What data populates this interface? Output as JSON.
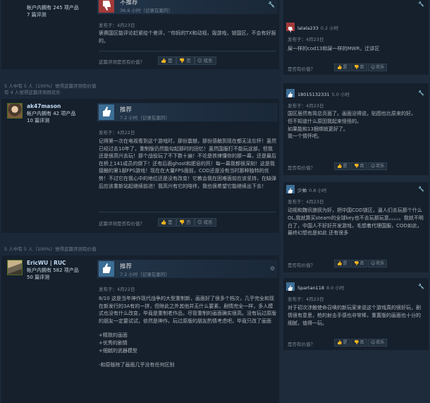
{
  "r0": {
    "stat1": "帐户内拥有 245 项产品",
    "stat2": "7 篇评测",
    "verdict": "不推荐",
    "hours": "36.6 小时（记录在案的）",
    "posted": "发布于：4月23日",
    "text": "褒赛国区能评论赶紧给个差评，‘’你妈的TX和动视，毁游戏，锁国区，不会有好报的。",
    "question": "这篇评测是否有价值？",
    "yes": "是",
    "no": "否",
    "funny": "欢乐"
  },
  "r1": {
    "helpful1": "5 人中有 5 人（100%）觉得这篇评测有价值",
    "helpful2": "有 4 人觉得这篇评测很欢乐",
    "name": "ak47mason",
    "stat1": "帐户内拥有 42 项产品",
    "stat2": "10 篇评测",
    "verdict": "推荐",
    "hours": "7.2 小时（记录在案的）",
    "posted": "发布于：4月22日",
    "text": "记得第一次在电视看到这个游戏时，那份震撼，那份感触到现在都无法忘怀！虽然已经过去10年了，重制版仍然能勾起那时的回忆！虽然国服打不能玩这部，但我还是很高兴去玩！那个战役玩了不下数十遍！不论是铁律懂你的那一幕，还是最后在桥上141成员的倒下！还有后面ghost和肥皂的死！每一幕我都很深刻！这是我接触的第1部FPS游戏！现在在大量FPS面前，COD还是没有当时那种独特的优势！不过它在我心中的地位还是没有改变！它教会我在困难面前应该坚持，在缺弹后应该重新站起继续前进！我高兴有它的陪伴，我也很希望它能继续出下去！",
    "question": "这篇评测是否有价值？",
    "yes": "是",
    "no": "否",
    "funny": "欢乐"
  },
  "r2": {
    "helpful1": "5 人中有 5 人（100%）觉得这篇评测有价值",
    "name": "EricWU | RUC",
    "stat1": "帐户内拥有 582 项产品",
    "stat2": "50 篇评测",
    "verdict": "推荐",
    "hours": "7.2 小时（记录在案的）",
    "posted": "发布于：4月22日",
    "lines": [
      "8/10 这是当年神作现代战争的大型重制新，画面好了很多个档次，几乎完全和现在新发行的3A有的一拼，但除此之外其他并无什么要素，剧情完全一样，多人模式也没有什么改变，毕竟是重制老作品，尽管重制的画面确实很高。没有玩过原版的朋友一定要试试，依然是神作。玩过原版的朋友酌情考虑吧，毕竟只改了画面",
      "",
      "+精致的画面",
      "+优秀的剧情",
      "+细腻的武器模型",
      "",
      "-和原版除了画面几乎没有任何区别"
    ]
  },
  "right": [
    {
      "user": "lalala233",
      "hours": "0.2 小时",
      "posted": "发布于：4月23日",
      "text": "屎一样的cod13和屎一样的MWR，迂讲区",
      "question": "是否有价值？",
      "yes": "是",
      "no": "否",
      "funny": "欢乐"
    },
    {
      "user": "18015132331",
      "hours": "5.0 小时",
      "posted": "发布于：4月23日",
      "text": "国区居然有简总页面了。画面没得说，贴图也比原来的好。\n但不知道什么原因我起来怪怪的。\n如果能和13捆绑就更好了。\n我一个情怀吧。",
      "question": "是否有价值？",
      "yes": "是",
      "no": "否",
      "funny": "欢乐"
    },
    {
      "user": "少帅",
      "hours": "0.8 小时",
      "posted": "发布于：4月23日",
      "text": "动视和魏讯狼狈为奸，把中国COD锁区，逼人们去玩那个什么OL,我就算买steam的全球key也不去玩那玩意。。。。。我就不明白了，中国人不好好开发游戏，毛想着代理国服，COD如此，最终幻想也是如此 还有很多",
      "question": "是否有价值？",
      "yes": "是",
      "no": "否",
      "funny": "欢乐"
    },
    {
      "user": "Spartan118",
      "hours": "8.0 小时",
      "posted": "发布于：4月23日",
      "text": "对于初次涉触使命召唤的新玩家来说这个游戏真的很好玩，剧情很有意思，枪的射击手感也非常棒，重置版的画面也十分的细腻，值得一玩。",
      "question": "是否有价值？",
      "yes": "是",
      "no": "否",
      "funny": "欢乐"
    }
  ],
  "icons": {
    "thumb_up": "thumbs-up-icon",
    "thumb_down": "thumbs-down-icon",
    "wrench": "wrench-icon",
    "steam": "steam-icon"
  },
  "colors": {
    "accent": "#67c1f5",
    "recommend": "#3c6e95",
    "notrecommend": "#a33a3a",
    "bg": "#1b2838"
  }
}
